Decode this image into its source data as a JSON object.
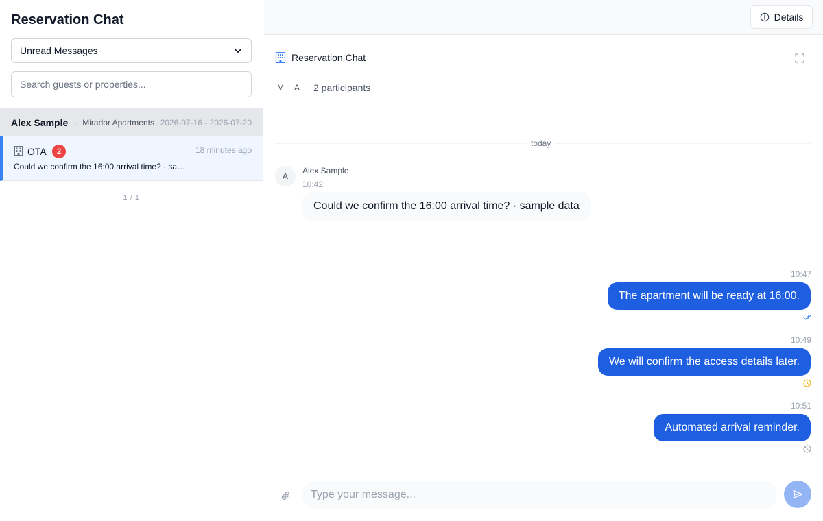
{
  "sidebar": {
    "title": "Reservation Chat",
    "filter": {
      "selected": "Unread Messages"
    },
    "search": {
      "placeholder": "Search guests or properties..."
    },
    "reservation": {
      "guest": "Alex Sample",
      "separator": "·",
      "property": "Mirador Apartments",
      "dates": "2026-07-16 - 2026-07-20"
    },
    "conversation": {
      "channel": "OTA",
      "unread": "2",
      "time": "18 minutes ago",
      "preview": "Could we confirm the 16:00 arrival time? · sample data"
    },
    "pager": "1 / 1"
  },
  "topbar": {
    "details_label": "Details"
  },
  "chat": {
    "title": "Reservation Chat",
    "participant_initials": [
      "M",
      "A"
    ],
    "participants_label": "2 participants",
    "day_label": "today",
    "incoming": {
      "avatar": "A",
      "sender": "Alex Sample",
      "time": "10:42",
      "text": "Could we confirm the 16:00 arrival time? · sample data"
    },
    "outgoing": [
      {
        "time": "10:47",
        "text": "The apartment will be ready at 16:00.",
        "status": "read-check-icon",
        "status_color": "#3b82f6"
      },
      {
        "time": "10:49",
        "text": "We will confirm the access details later.",
        "status": "pending-clock-icon",
        "status_color": "#eab308"
      },
      {
        "time": "10:51",
        "text": "Automated arrival reminder.",
        "status": "blocked-icon",
        "status_color": "#9ca3af"
      }
    ]
  },
  "composer": {
    "placeholder": "Type your message..."
  },
  "colors": {
    "accent": "#1d5fe0",
    "badge": "#ef4444",
    "selected_row": "#eff6ff",
    "selected_border": "#3b82f6"
  }
}
